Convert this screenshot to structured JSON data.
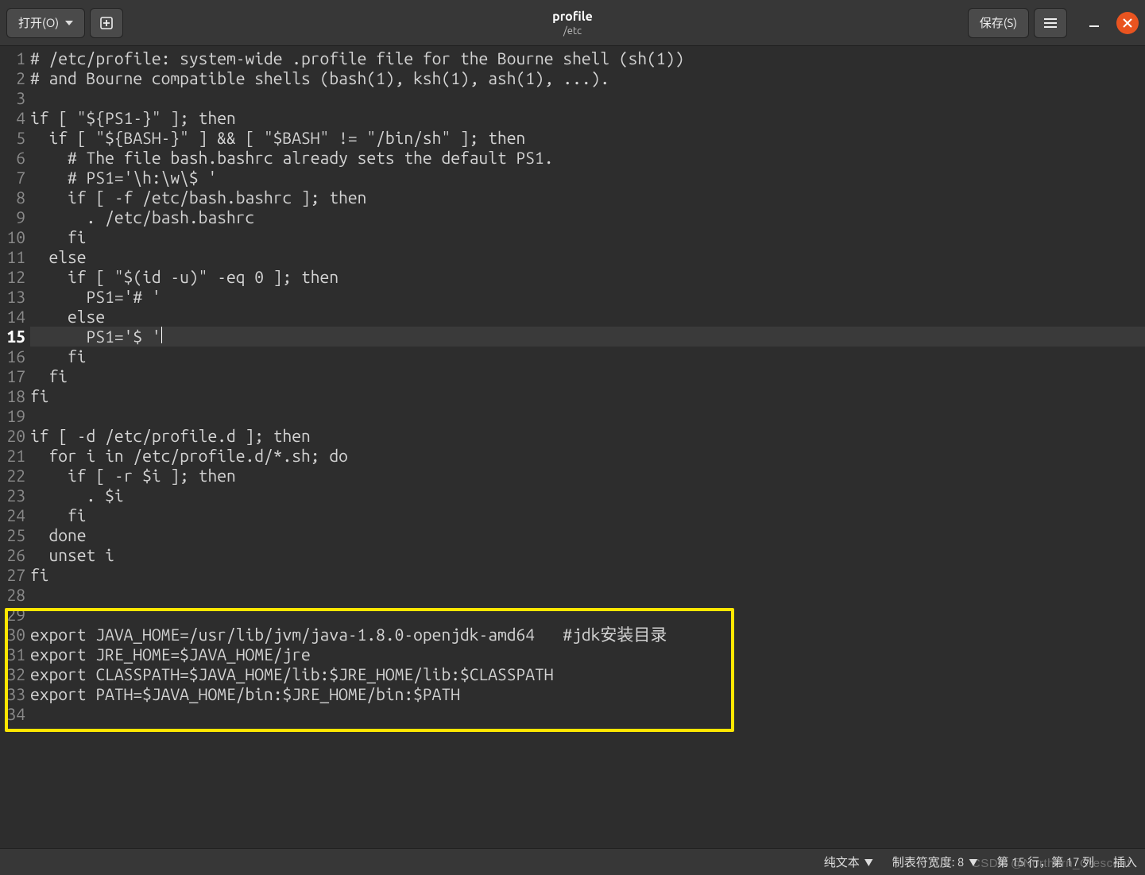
{
  "header": {
    "open_label": "打开(O)",
    "save_label": "保存(S)",
    "title": "profile",
    "subtitle": "/etc"
  },
  "editor": {
    "current_line": 15,
    "lines": [
      "# /etc/profile: system-wide .profile file for the Bourne shell (sh(1))",
      "# and Bourne compatible shells (bash(1), ksh(1), ash(1), ...).",
      "",
      "if [ \"${PS1-}\" ]; then",
      "  if [ \"${BASH-}\" ] && [ \"$BASH\" != \"/bin/sh\" ]; then",
      "    # The file bash.bashrc already sets the default PS1.",
      "    # PS1='\\h:\\w\\$ '",
      "    if [ -f /etc/bash.bashrc ]; then",
      "      . /etc/bash.bashrc",
      "    fi",
      "  else",
      "    if [ \"$(id -u)\" -eq 0 ]; then",
      "      PS1='# '",
      "    else",
      "      PS1='$ '",
      "    fi",
      "  fi",
      "fi",
      "",
      "if [ -d /etc/profile.d ]; then",
      "  for i in /etc/profile.d/*.sh; do",
      "    if [ -r $i ]; then",
      "      . $i",
      "    fi",
      "  done",
      "  unset i",
      "fi",
      "",
      "",
      "export JAVA_HOME=/usr/lib/jvm/java-1.8.0-openjdk-amd64   #jdk安装目录",
      "export JRE_HOME=$JAVA_HOME/jre",
      "export CLASSPATH=$JAVA_HOME/lib:$JRE_HOME/lib:$CLASSPATH",
      "export PATH=$JAVA_HOME/bin:$JRE_HOME/bin:$PATH",
      ""
    ]
  },
  "status": {
    "lang": "纯文本",
    "tab_label": "制表符宽度: 8",
    "pos": "第 15 行，第 17 列",
    "ins": "插入"
  },
  "watermark": "CSDN @Northern_Crescent"
}
